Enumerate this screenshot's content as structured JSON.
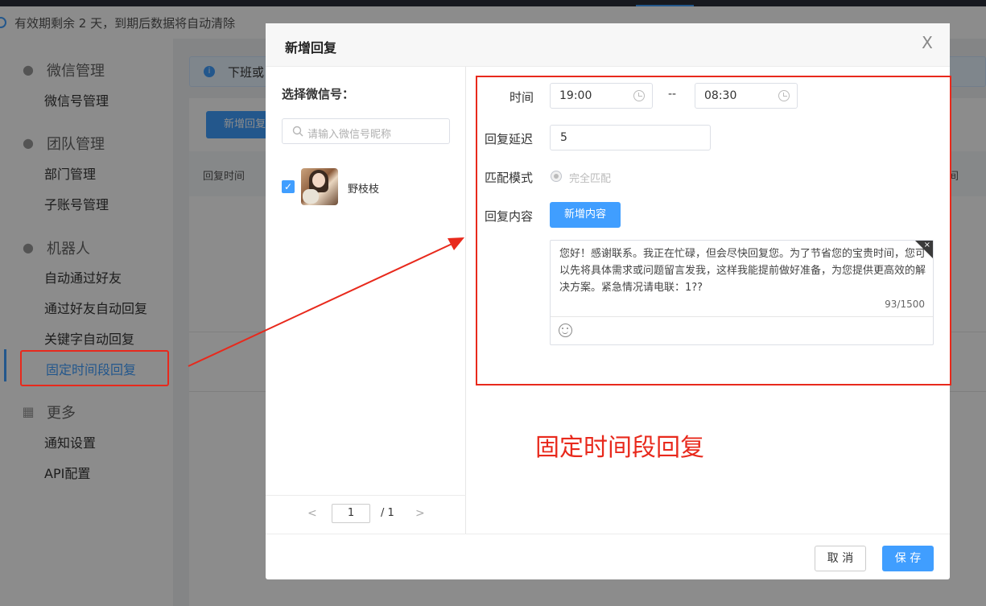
{
  "notice": {
    "text": "有效期剩余 2 天，到期后数据将自动清除"
  },
  "sidebar": {
    "groups": [
      {
        "label": "微信管理",
        "icon": "wechat-icon",
        "items": [
          "微信号管理"
        ]
      },
      {
        "label": "团队管理",
        "icon": "team-icon",
        "items": [
          "部门管理",
          "子账号管理"
        ]
      },
      {
        "label": "机器人",
        "icon": "robot-icon",
        "items": [
          "自动通过好友",
          "通过好友自动回复",
          "关键字自动回复",
          "固定时间段回复"
        ]
      },
      {
        "label": "更多",
        "icon": "grid-icon",
        "items": [
          "通知设置",
          "API配置"
        ]
      }
    ],
    "active_item": "固定时间段回复"
  },
  "background": {
    "info_text": "下班或",
    "add_button": "新增回复",
    "table_col_first": "回复时间",
    "table_col_last": "间"
  },
  "modal": {
    "title": "新增回复",
    "close": "X",
    "left": {
      "title": "选择微信号：",
      "search_placeholder": "请输入微信号昵称",
      "accounts": [
        {
          "name": "野枝枝",
          "checked": true
        }
      ],
      "pager": {
        "prev": "<",
        "current": "1",
        "total": "/ 1",
        "next": ">"
      }
    },
    "form": {
      "time_label": "时间",
      "time_start": "19:00",
      "time_sep": "--",
      "time_end": "08:30",
      "delay_label": "回复延迟",
      "delay_value": "5",
      "match_label": "匹配模式",
      "match_option": "完全匹配",
      "content_label": "回复内容",
      "add_content_button": "新增内容",
      "content_text": "您好！感谢联系。我正在忙碌，但会尽快回复您。为了节省您的宝贵时间，您可以先将具体需求或问题留言发我，这样我能提前做好准备，为您提供更高效的解决方案。紧急情况请电联：1??",
      "char_count": "93/1500",
      "corner_close": "×"
    },
    "footer": {
      "cancel": "取 消",
      "save": "保 存"
    }
  },
  "annotation": {
    "label": "固定时间段回复",
    "color": "#e8291c"
  },
  "colors": {
    "primary": "#409eff",
    "annotation": "#e8291c"
  }
}
